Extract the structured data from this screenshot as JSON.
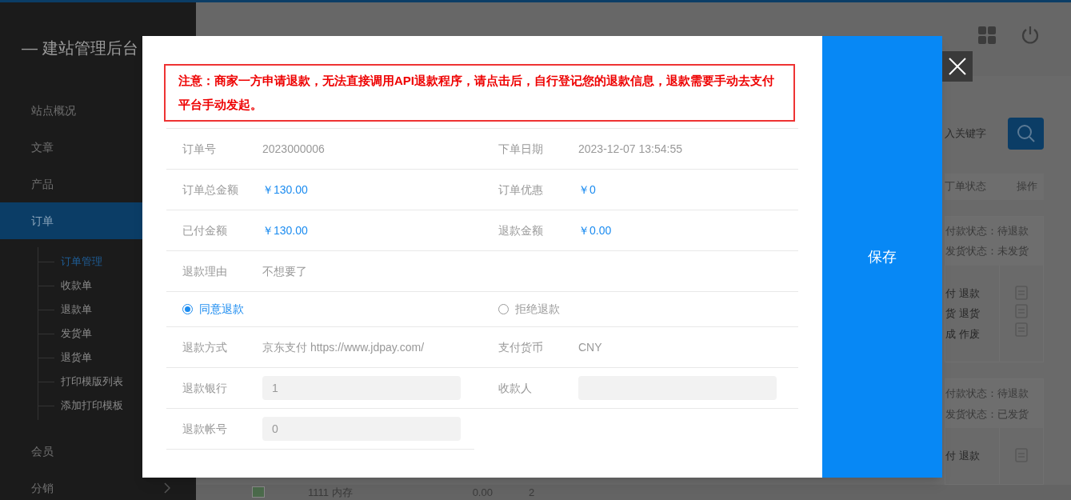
{
  "sidebar": {
    "title": "— 建站管理后台",
    "items": [
      {
        "label": "站点概况",
        "selected": false
      },
      {
        "label": "文章",
        "selected": false
      },
      {
        "label": "产品",
        "selected": false
      },
      {
        "label": "订单",
        "selected": true,
        "expanded": true,
        "children": [
          {
            "label": "订单管理",
            "selected": true
          },
          {
            "label": "收款单",
            "selected": false
          },
          {
            "label": "退款单",
            "selected": false
          },
          {
            "label": "发货单",
            "selected": false
          },
          {
            "label": "退货单",
            "selected": false
          },
          {
            "label": "打印模版列表",
            "selected": false
          },
          {
            "label": "添加打印模板",
            "selected": false
          }
        ]
      },
      {
        "label": "会员",
        "selected": false
      },
      {
        "label": "分销",
        "selected": false,
        "expanded": false
      }
    ]
  },
  "background": {
    "search": {
      "placeholder": "入关键字"
    },
    "columns": [
      "丁单状态",
      "操作"
    ],
    "orders": [
      {
        "pay_status": "付款状态：待退款",
        "ship_status": "发货状态：未发货",
        "actions": [
          "付 退款",
          "货 退货",
          "成 作废"
        ]
      },
      {
        "pay_status": "付款状态：待退款",
        "ship_status": "发货状态：已发货",
        "actions": [
          "付 退款"
        ]
      }
    ],
    "bottom_row": {
      "name": "1111 内存",
      "price": "0.00",
      "quantity": "2"
    }
  },
  "dialog": {
    "notice": "注意：商家一方申请退款，无法直接调用API退款程序，请点击后，自行登记您的退款信息，退款需要手动去支付平台手动发起。",
    "rows": [
      {
        "kind": "pair",
        "cells": [
          {
            "label": "订单号",
            "value": "2023000006",
            "kind": "text"
          },
          {
            "label": "下单日期",
            "value": "2023-12-07 13:54:55",
            "kind": "text"
          }
        ]
      },
      {
        "kind": "pair",
        "cells": [
          {
            "label": "订单总金额",
            "value": "￥130.00",
            "kind": "money"
          },
          {
            "label": "订单优惠",
            "value": "￥0",
            "kind": "money"
          }
        ]
      },
      {
        "kind": "pair",
        "cells": [
          {
            "label": "已付金额",
            "value": "￥130.00",
            "kind": "money"
          },
          {
            "label": "退款金额",
            "value": "￥0.00",
            "kind": "money"
          }
        ]
      },
      {
        "kind": "pair",
        "cells": [
          {
            "label": "退款理由",
            "value": "不想要了",
            "kind": "text"
          }
        ]
      },
      {
        "kind": "radio",
        "options": [
          {
            "label": "同意退款",
            "selected": true
          },
          {
            "label": "拒绝退款",
            "selected": false
          }
        ]
      },
      {
        "kind": "pair",
        "cells": [
          {
            "label": "退款方式",
            "value": "京东支付 https://www.jdpay.com/",
            "kind": "text"
          },
          {
            "label": "支付货币",
            "value": "CNY",
            "kind": "text"
          }
        ]
      },
      {
        "kind": "pair",
        "cells": [
          {
            "label": "退款银行",
            "value": "1",
            "kind": "input"
          },
          {
            "label": "收款人",
            "kind": "input"
          }
        ]
      },
      {
        "kind": "half",
        "cells": [
          {
            "label": "退款帐号",
            "value": "0",
            "kind": "input"
          }
        ]
      }
    ],
    "save": "保存"
  }
}
